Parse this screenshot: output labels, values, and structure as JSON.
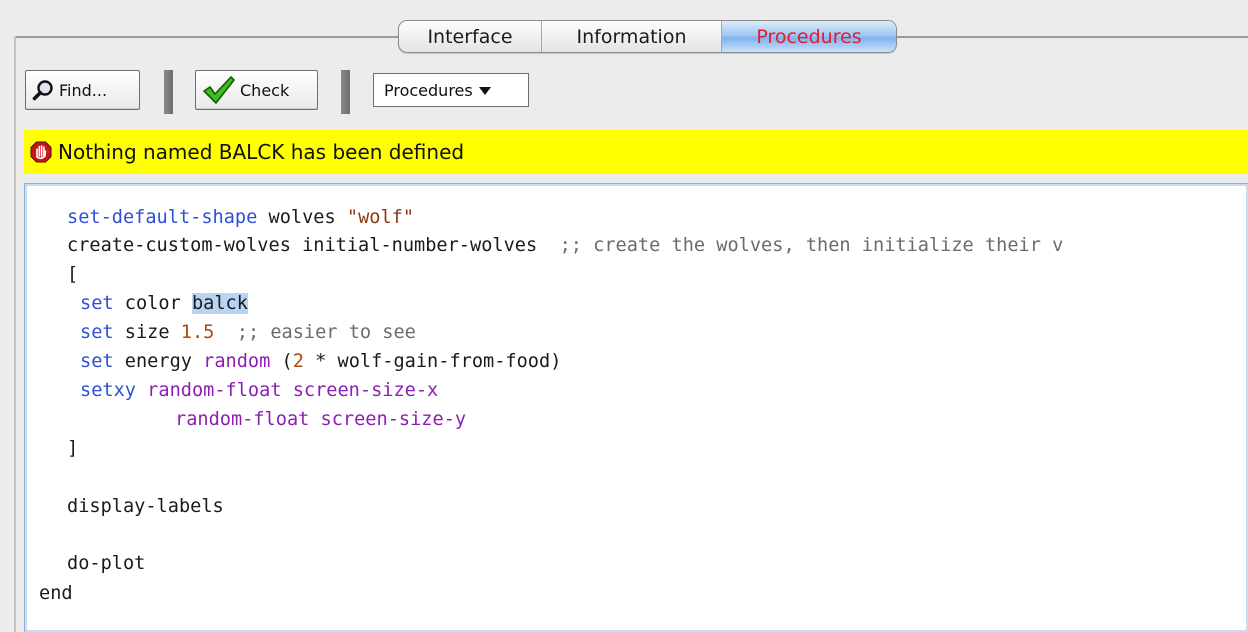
{
  "tabs": {
    "interface": "Interface",
    "information": "Information",
    "procedures": "Procedures"
  },
  "toolbar": {
    "find_label": "Find...",
    "check_label": "Check",
    "procedures_dropdown": "Procedures"
  },
  "error": {
    "message": "Nothing named BALCK has been defined"
  },
  "code": {
    "l1_kw": "set-default-shape",
    "l1_txt": " wolves ",
    "l1_str": "\"wolf\"",
    "l2_txt": "create-custom-wolves initial-number-wolves  ",
    "l2_cmt": ";; create the wolves, then initialize their v",
    "l3": "[",
    "l4_kw": "set",
    "l4_txt": " color ",
    "l4_sel": "balck",
    "l5_kw": "set",
    "l5_txt": " size ",
    "l5_num": "1.5",
    "l5_cmt": "  ;; easier to see",
    "l6_kw": "set",
    "l6_txt": " energy ",
    "l6_rep": "random",
    "l6_txt2": " (",
    "l6_num": "2",
    "l6_txt3": " * wolf-gain-from-food)",
    "l7_kw": "setxy",
    "l7_rep": " random-float screen-size-x",
    "l8_rep": "random-float screen-size-y",
    "l9": "]",
    "l10": "display-labels",
    "l11": "do-plot",
    "l12": "end"
  },
  "colors": {
    "error_bar": "#ffff00",
    "active_tab_text": "#e8192c",
    "keyword": "#2d4fd6",
    "reporter": "#8c1fb3",
    "string": "#8b3a0c",
    "comment": "#6b6b6b",
    "selection": "#b9d4f3"
  },
  "icons": {
    "find": "magnifier-icon",
    "check": "checkmark-icon",
    "dropdown": "triangle-down-icon",
    "error": "stop-hand-icon"
  }
}
